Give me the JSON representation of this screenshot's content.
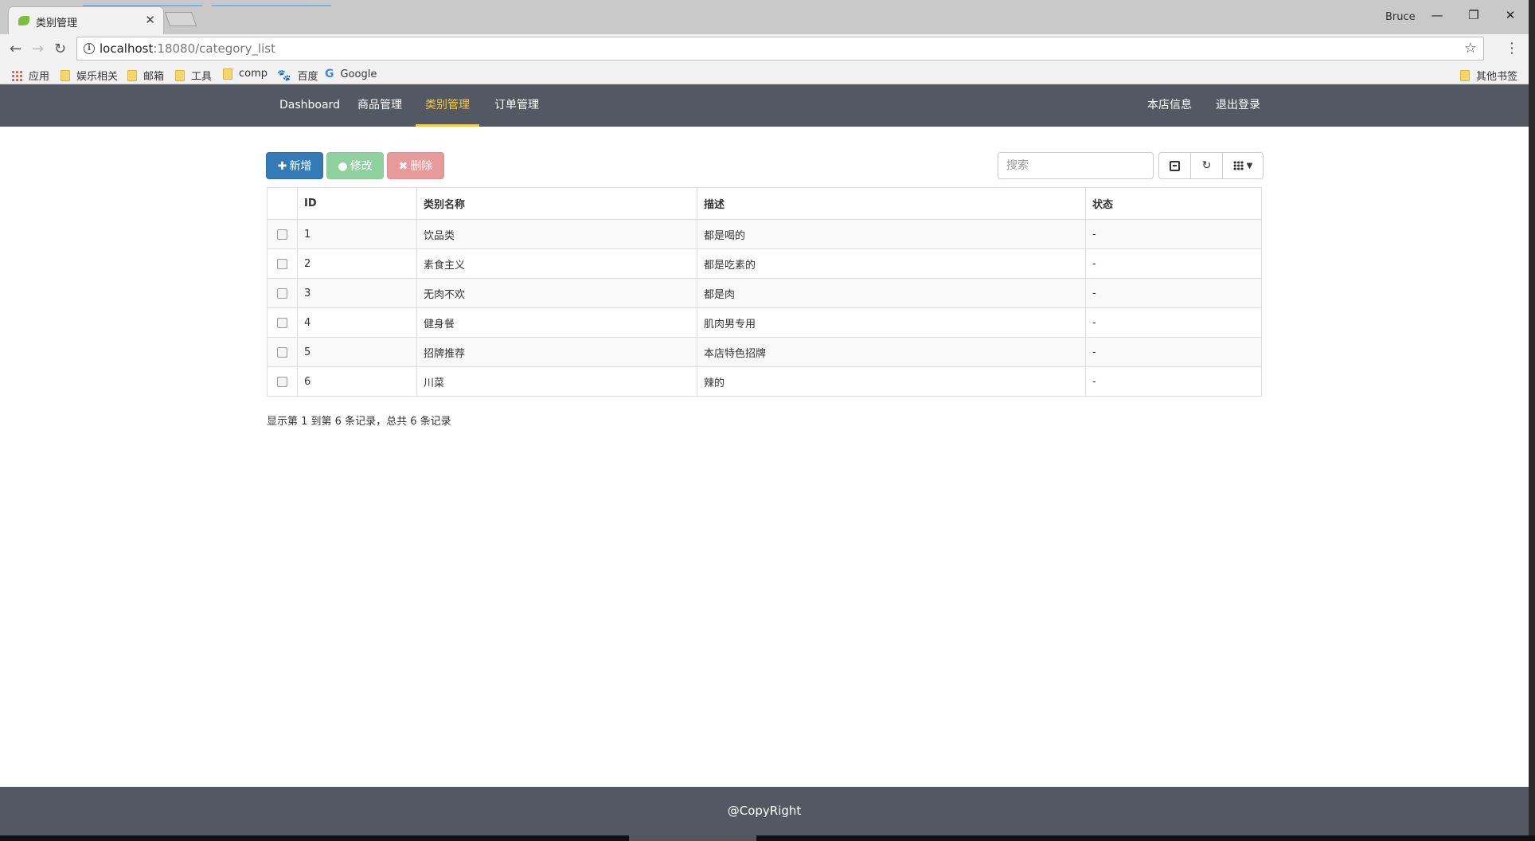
{
  "browser": {
    "tab_title": "类别管理",
    "profile": "Bruce",
    "url_host": "localhost",
    "url_rest": ":18080/category_list",
    "bookmarks": [
      {
        "label": "应用",
        "icon": "apps-icon"
      },
      {
        "label": "娱乐相关",
        "icon": "folder-icon"
      },
      {
        "label": "邮箱",
        "icon": "folder-icon"
      },
      {
        "label": "工具",
        "icon": "folder-icon"
      },
      {
        "label": "comp",
        "icon": "folder-icon"
      },
      {
        "label": "百度",
        "icon": "baidu-paw-icon"
      },
      {
        "label": "Google",
        "icon": "google-icon"
      }
    ],
    "other_bookmarks": "其他书签"
  },
  "nav": {
    "items": [
      "Dashboard",
      "商品管理",
      "类别管理",
      "订单管理"
    ],
    "active": "类别管理",
    "right": [
      "本店信息",
      "退出登录"
    ]
  },
  "actions": {
    "add": "新增",
    "edit": "修改",
    "delete": "删除"
  },
  "search": {
    "placeholder": "搜索"
  },
  "table": {
    "headers": [
      "ID",
      "类别名称",
      "描述",
      "状态"
    ],
    "rows": [
      {
        "id": "1",
        "name": "饮品类",
        "desc": "都是喝的",
        "status": "-"
      },
      {
        "id": "2",
        "name": "素食主义",
        "desc": "都是吃素的",
        "status": "-"
      },
      {
        "id": "3",
        "name": "无肉不欢",
        "desc": "都是肉",
        "status": "-"
      },
      {
        "id": "4",
        "name": "健身餐",
        "desc": "肌肉男专用",
        "status": "-"
      },
      {
        "id": "5",
        "name": "招牌推荐",
        "desc": "本店特色招牌",
        "status": "-"
      },
      {
        "id": "6",
        "name": "川菜",
        "desc": "辣的",
        "status": "-"
      }
    ]
  },
  "summary": "显示第 1 到第 6 条记录，总共 6 条记录",
  "footer": "@CopyRight",
  "colors": {
    "navbar": "#525962",
    "active": "#f7c948",
    "primary": "#337ab7",
    "success": "#8fd19e",
    "danger": "#e79a9a"
  }
}
